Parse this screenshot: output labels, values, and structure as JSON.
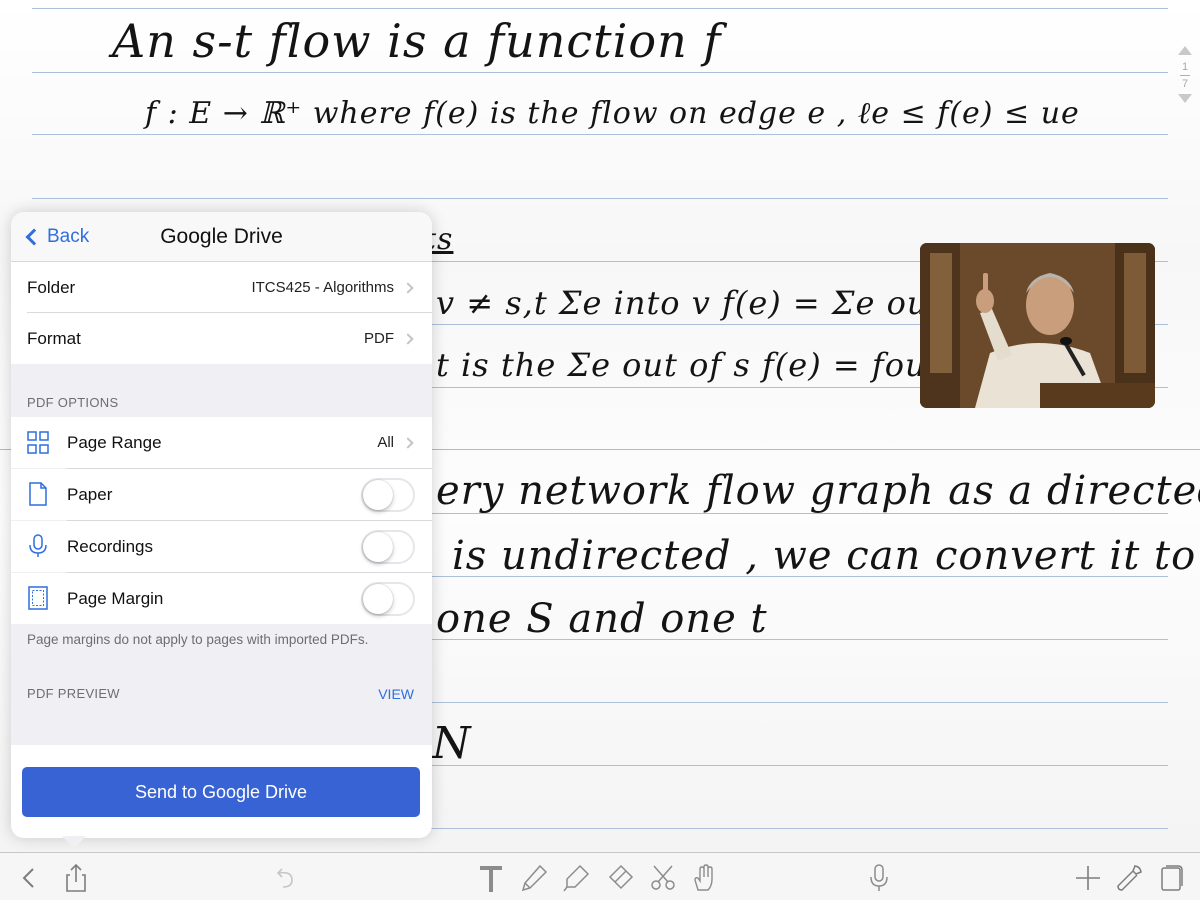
{
  "notes": {
    "lines": [
      "An s-t flow is a function f",
      "f : E → ℝ⁺ where f(e) is the flow on edge e , ℓe ≤ f(e) ≤ ue",
      "ts",
      "v ≠ s,t   Σe into v f(e) = Σe out of v f(e)",
      "t is the Σe out of s f(e) = fout(s)",
      "ery network flow graph as a directed",
      "is undirected , we can convert it to directed",
      "one S and one t",
      "N"
    ],
    "page_current": "1",
    "page_total": "7"
  },
  "popover": {
    "back_label": "Back",
    "title": "Google Drive",
    "folder_label": "Folder",
    "folder_value": "ITCS425 - Algorithms",
    "format_label": "Format",
    "format_value": "PDF",
    "pdf_options_header": "PDF OPTIONS",
    "page_range_label": "Page Range",
    "page_range_value": "All",
    "paper_label": "Paper",
    "paper_on": false,
    "recordings_label": "Recordings",
    "recordings_on": false,
    "page_margin_label": "Page Margin",
    "page_margin_on": false,
    "margin_note": "Page margins do not apply to pages with imported PDFs.",
    "pdf_preview_header": "PDF PREVIEW",
    "view_label": "VIEW",
    "send_label": "Send to Google Drive"
  },
  "toolbar": {
    "icons": [
      "back-chevron-icon",
      "share-icon",
      "undo-icon",
      "text-tool-icon",
      "pen-icon",
      "highlighter-icon",
      "eraser-icon",
      "scissors-icon",
      "hand-icon",
      "microphone-icon",
      "add-icon",
      "wrench-icon",
      "page-icon"
    ]
  },
  "colors": {
    "accent": "#2f6fe0",
    "send_button": "#3863d5",
    "rule_lines": "#aebfdb"
  }
}
